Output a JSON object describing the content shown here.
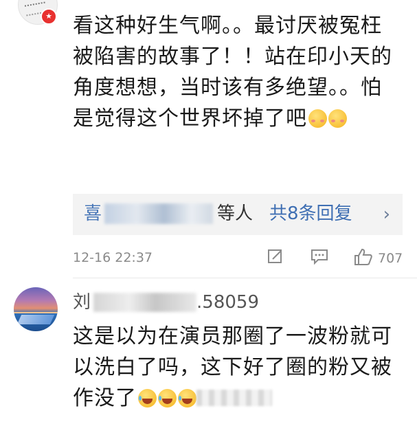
{
  "comment1": {
    "text": "看这种好生气啊。。最讨厌被冤枉被陷害的故事了！！站在印小天的角度想想，当时该有多绝望。。怕是觉得这个世界坏掉了吧",
    "reply_prefix": "喜",
    "reply_suffix": "等人",
    "reply_count": "共8条回复",
    "time": "12-16 22:37",
    "likes": "707"
  },
  "comment2": {
    "username_prefix": "刘",
    "username_suffix": ".58059",
    "text": "这是以为在演员那圈了一波粉就可以洗白了吗，这下好了圈的粉又被作没了"
  },
  "icons": {
    "verified": "verified-badge-icon",
    "edit": "edit-icon",
    "reply": "comment-icon",
    "like": "thumbs-up-icon",
    "more": "chevron-right-icon"
  },
  "colors": {
    "link": "#4a78b8",
    "badge": "#e8312f",
    "meta": "#8a8a8a"
  }
}
